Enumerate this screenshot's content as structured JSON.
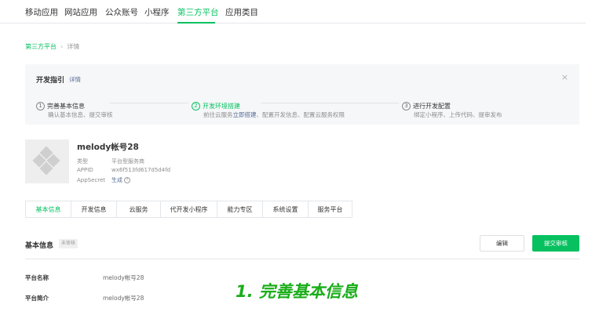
{
  "topnav": {
    "tabs": [
      {
        "label": "移动应用"
      },
      {
        "label": "网站应用"
      },
      {
        "label": "公众账号"
      },
      {
        "label": "小程序"
      },
      {
        "label": "第三方平台",
        "active": true
      },
      {
        "label": "应用类目"
      }
    ]
  },
  "breadcrumb": {
    "root": "第三方平台",
    "separator": "›",
    "current": "详情"
  },
  "guide": {
    "title": "开发指引",
    "details_link": "详情",
    "close_glyph": "×",
    "steps": [
      {
        "number": "1",
        "label": "完善基本信息",
        "desc": "确认基本信息、提交审核"
      },
      {
        "number": "2",
        "label": "开发环境搭建",
        "desc_prefix": "前往云服务",
        "desc_link": "立即搭建",
        "desc_suffix": "、配置开发信息、配置云服务权限",
        "active": true
      },
      {
        "number": "3",
        "label": "进行开发配置",
        "desc": "绑定小程序、上传代码、提审发布"
      }
    ]
  },
  "account": {
    "name": "melody帐号28",
    "type_label": "类型",
    "type_value": "平台型服务商",
    "appid_label": "APPID",
    "appid_value": "wx6f513fd617d5d4fd",
    "secret_label": "AppSecret",
    "secret_action": "生成",
    "help_glyph": "?"
  },
  "subtabs": [
    {
      "label": "基本信息",
      "active": true
    },
    {
      "label": "开发信息"
    },
    {
      "label": "云服务"
    },
    {
      "label": "代开发小程序"
    },
    {
      "label": "能力专区"
    },
    {
      "label": "系统设置"
    },
    {
      "label": "服务平台"
    }
  ],
  "basic_info": {
    "title": "基本信息",
    "status_badge": "未审核",
    "edit_label": "编辑",
    "submit_label": "提交审核",
    "fields": [
      {
        "label": "平台名称",
        "value": "melody帐号28"
      },
      {
        "label": "平台简介",
        "value": "melody帐号28"
      }
    ]
  },
  "overlay_caption": "1. 完善基本信息",
  "colors": {
    "accent": "#07c160",
    "link": "#576b95",
    "caption": "#1aad19"
  }
}
